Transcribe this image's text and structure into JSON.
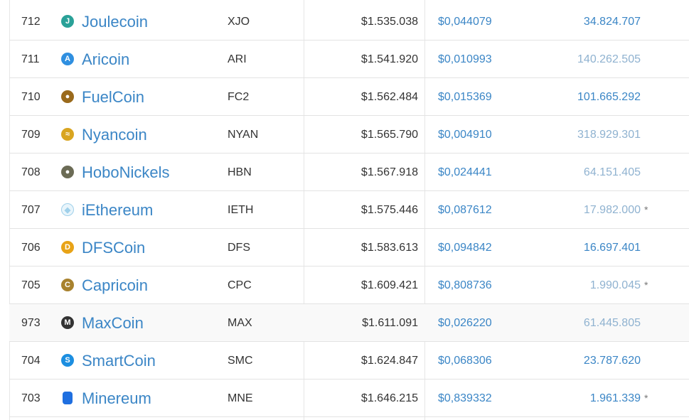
{
  "table": {
    "rows": [
      {
        "rank": "712",
        "name": "Joulecoin",
        "symbol": "XJO",
        "market_cap": "$1.535.038",
        "price": "$0,044079",
        "supply": "34.824.707",
        "supply_tone": "dark",
        "note": "",
        "logo_icon": "joulecoin-logo-icon",
        "logo_color": "#2aa198"
      },
      {
        "rank": "711",
        "name": "Aricoin",
        "symbol": "ARI",
        "market_cap": "$1.541.920",
        "price": "$0,010993",
        "supply": "140.262.505",
        "supply_tone": "light",
        "note": "",
        "logo_icon": "aricoin-logo-icon",
        "logo_color": "#2f8fe0"
      },
      {
        "rank": "710",
        "name": "FuelCoin",
        "symbol": "FC2",
        "market_cap": "$1.562.484",
        "price": "$0,015369",
        "supply": "101.665.292",
        "supply_tone": "dark",
        "note": "",
        "logo_icon": "fuelcoin-logo-icon",
        "logo_color": "#9a6a1c"
      },
      {
        "rank": "709",
        "name": "Nyancoin",
        "symbol": "NYAN",
        "market_cap": "$1.565.790",
        "price": "$0,004910",
        "supply": "318.929.301",
        "supply_tone": "light",
        "note": "",
        "logo_icon": "nyancoin-logo-icon",
        "logo_color": "#d9a520"
      },
      {
        "rank": "708",
        "name": "HoboNickels",
        "symbol": "HBN",
        "market_cap": "$1.567.918",
        "price": "$0,024441",
        "supply": "64.151.405",
        "supply_tone": "light",
        "note": "",
        "logo_icon": "hobonickels-logo-icon",
        "logo_color": "#6b6b55"
      },
      {
        "rank": "707",
        "name": "iEthereum",
        "symbol": "IETH",
        "market_cap": "$1.575.446",
        "price": "$0,087612",
        "supply": "17.982.000",
        "supply_tone": "light",
        "note": "*",
        "logo_icon": "iethereum-logo-icon",
        "logo_color": "#9fd0ea"
      },
      {
        "rank": "706",
        "name": "DFSCoin",
        "symbol": "DFS",
        "market_cap": "$1.583.613",
        "price": "$0,094842",
        "supply": "16.697.401",
        "supply_tone": "dark",
        "note": "",
        "logo_icon": "dfscoin-logo-icon",
        "logo_color": "#e8a317"
      },
      {
        "rank": "705",
        "name": "Capricoin",
        "symbol": "CPC",
        "market_cap": "$1.609.421",
        "price": "$0,808736",
        "supply": "1.990.045",
        "supply_tone": "light",
        "note": "*",
        "logo_icon": "capricoin-logo-icon",
        "logo_color": "#a8822e"
      },
      {
        "rank": "973",
        "name": "MaxCoin",
        "symbol": "MAX",
        "market_cap": "$1.611.091",
        "price": "$0,026220",
        "supply": "61.445.805",
        "supply_tone": "light",
        "note": "",
        "logo_icon": "maxcoin-logo-icon",
        "logo_color": "#333333"
      },
      {
        "rank": "704",
        "name": "SmartCoin",
        "symbol": "SMC",
        "market_cap": "$1.624.847",
        "price": "$0,068306",
        "supply": "23.787.620",
        "supply_tone": "dark",
        "note": "",
        "logo_icon": "smartcoin-logo-icon",
        "logo_color": "#1c8ee0"
      },
      {
        "rank": "703",
        "name": "Minereum",
        "symbol": "MNE",
        "market_cap": "$1.646.215",
        "price": "$0,839332",
        "supply": "1.961.339",
        "supply_tone": "dark",
        "note": "*",
        "logo_icon": "minereum-logo-icon",
        "logo_color": "#1f6fe0"
      }
    ]
  }
}
